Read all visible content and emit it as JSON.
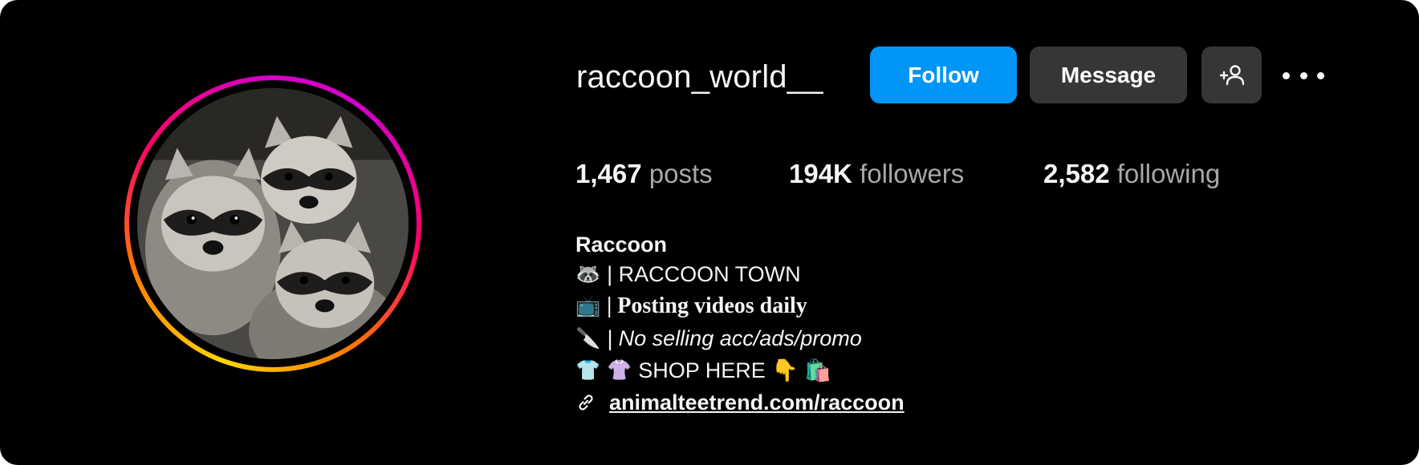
{
  "profile": {
    "username": "raccoon_world__",
    "follow_label": "Follow",
    "message_label": "Message",
    "stats": {
      "posts_count": "1,467",
      "posts_label": "posts",
      "followers_count": "194K",
      "followers_label": "followers",
      "following_count": "2,582",
      "following_label": "following"
    },
    "bio": {
      "name": "Raccoon",
      "lines": [
        {
          "emoji": "🦝",
          "text": "| RACCOON TOWN"
        },
        {
          "emoji": "📺",
          "text": "| Posting videos daily"
        },
        {
          "emoji": "🔪",
          "text": "| No selling acc/ads/promo"
        },
        {
          "emoji": "👕 👚",
          "text": "SHOP HERE 👇 🛍️"
        }
      ],
      "link": "animalteetrend.com/raccoon"
    }
  },
  "colors": {
    "background": "#000000",
    "follow_button": "#0095f6",
    "secondary_button": "#363636",
    "primary_text": "#f5f5f5",
    "muted_text": "#a8a8a8"
  },
  "icons": {
    "add_user": "person-plus-icon",
    "more": "more-horizontal-icon",
    "link": "link-icon"
  }
}
